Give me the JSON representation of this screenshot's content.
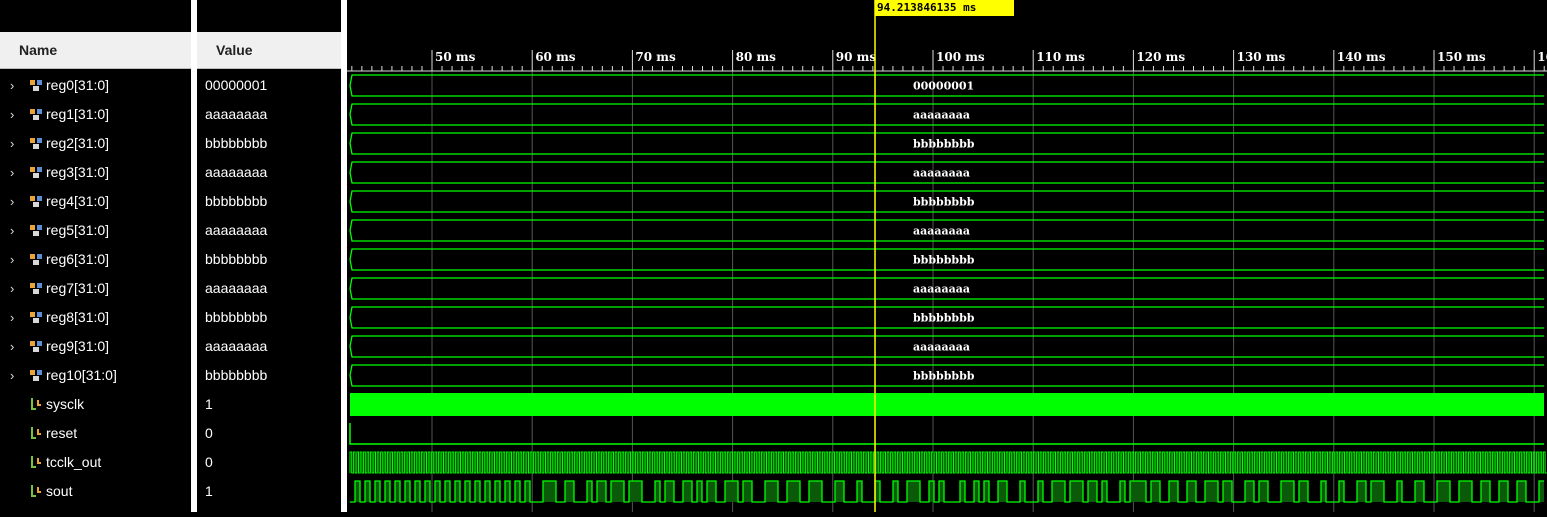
{
  "headers": {
    "name": "Name",
    "value": "Value"
  },
  "cursor": {
    "label": "94.213846135 ms",
    "time_ms": 94.213846135
  },
  "timeline": {
    "tick_labels": [
      "50 ms",
      "60 ms",
      "70 ms",
      "80 ms",
      "90 ms",
      "100 ms",
      "110 ms",
      "120 ms",
      "130 ms",
      "140 ms",
      "150 ms",
      "16"
    ]
  },
  "signals": [
    {
      "name": "reg0[31:0]",
      "value": "00000001",
      "type": "bus",
      "wave_label": "00000001"
    },
    {
      "name": "reg1[31:0]",
      "value": "aaaaaaaa",
      "type": "bus",
      "wave_label": "aaaaaaaa"
    },
    {
      "name": "reg2[31:0]",
      "value": "bbbbbbbb",
      "type": "bus",
      "wave_label": "bbbbbbbb"
    },
    {
      "name": "reg3[31:0]",
      "value": "aaaaaaaa",
      "type": "bus",
      "wave_label": "aaaaaaaa"
    },
    {
      "name": "reg4[31:0]",
      "value": "bbbbbbbb",
      "type": "bus",
      "wave_label": "bbbbbbbb"
    },
    {
      "name": "reg5[31:0]",
      "value": "aaaaaaaa",
      "type": "bus",
      "wave_label": "aaaaaaaa"
    },
    {
      "name": "reg6[31:0]",
      "value": "bbbbbbbb",
      "type": "bus",
      "wave_label": "bbbbbbbb"
    },
    {
      "name": "reg7[31:0]",
      "value": "aaaaaaaa",
      "type": "bus",
      "wave_label": "aaaaaaaa"
    },
    {
      "name": "reg8[31:0]",
      "value": "bbbbbbbb",
      "type": "bus",
      "wave_label": "bbbbbbbb"
    },
    {
      "name": "reg9[31:0]",
      "value": "aaaaaaaa",
      "type": "bus",
      "wave_label": "aaaaaaaa"
    },
    {
      "name": "reg10[31:0]",
      "value": "bbbbbbbb",
      "type": "bus",
      "wave_label": "bbbbbbbb"
    },
    {
      "name": "sysclk",
      "value": "1",
      "type": "bit",
      "wave": "dense"
    },
    {
      "name": "reset",
      "value": "0",
      "type": "bit",
      "wave": "low"
    },
    {
      "name": "tcclk_out",
      "value": "0",
      "type": "bit",
      "wave": "clock"
    },
    {
      "name": "sout",
      "value": "1",
      "type": "bit",
      "wave": "serial"
    }
  ],
  "colors": {
    "wave": "#00ff00",
    "cursor": "#ffff00",
    "background": "#000000",
    "header": "#f0f0f0"
  },
  "icons": {
    "bus": "bus-signal-icon",
    "bit": "bit-signal-icon",
    "expand": "chevron-right-icon"
  }
}
